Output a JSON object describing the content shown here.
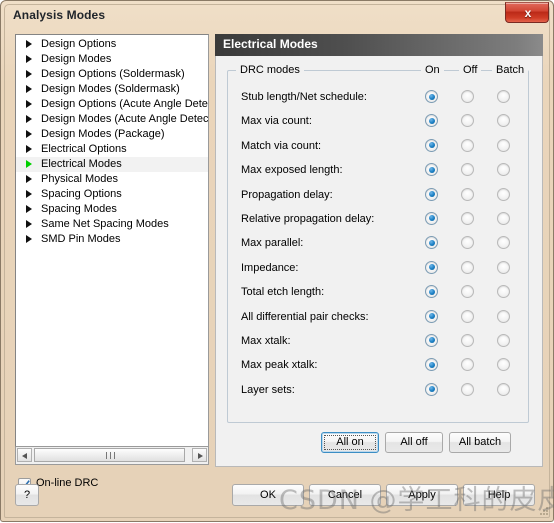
{
  "window": {
    "title": "Analysis Modes",
    "close_label": "x"
  },
  "tree": {
    "items": [
      {
        "label": "Design Options",
        "selected": false
      },
      {
        "label": "Design Modes",
        "selected": false
      },
      {
        "label": "Design Options (Soldermask)",
        "selected": false
      },
      {
        "label": "Design Modes  (Soldermask)",
        "selected": false
      },
      {
        "label": "Design Options (Acute Angle Detection)",
        "selected": false
      },
      {
        "label": "Design Modes  (Acute Angle Detection)",
        "selected": false
      },
      {
        "label": "Design Modes  (Package)",
        "selected": false
      },
      {
        "label": "Electrical Options",
        "selected": false
      },
      {
        "label": "Electrical Modes",
        "selected": true
      },
      {
        "label": "Physical Modes",
        "selected": false
      },
      {
        "label": "Spacing Options",
        "selected": false
      },
      {
        "label": "Spacing Modes",
        "selected": false
      },
      {
        "label": "Same Net Spacing Modes",
        "selected": false
      },
      {
        "label": "SMD Pin Modes",
        "selected": false
      }
    ]
  },
  "pane": {
    "header": "Electrical Modes",
    "group_title": "DRC modes",
    "columns": [
      "On",
      "Off",
      "Batch"
    ],
    "rows": [
      {
        "label": "Stub length/Net schedule:",
        "value": "On"
      },
      {
        "label": "Max via count:",
        "value": "On"
      },
      {
        "label": "Match via count:",
        "value": "On"
      },
      {
        "label": "Max exposed length:",
        "value": "On"
      },
      {
        "label": "Propagation delay:",
        "value": "On"
      },
      {
        "label": "Relative propagation delay:",
        "value": "On"
      },
      {
        "label": "Max parallel:",
        "value": "On"
      },
      {
        "label": "Impedance:",
        "value": "On"
      },
      {
        "label": "Total etch length:",
        "value": "On"
      },
      {
        "label": "All differential pair checks:",
        "value": "On"
      },
      {
        "label": "Max xtalk:",
        "value": "On"
      },
      {
        "label": "Max peak xtalk:",
        "value": "On"
      },
      {
        "label": "Layer sets:",
        "value": "On"
      }
    ],
    "buttons": {
      "all_on": "All on",
      "all_off": "All off",
      "all_batch": "All batch"
    }
  },
  "options": {
    "online_drc_label": "On-line DRC",
    "online_drc_checked": true
  },
  "footer": {
    "help_small": "?",
    "ok": "OK",
    "cancel": "Cancel",
    "apply": "Apply",
    "help": "Help"
  },
  "watermark": {
    "text": "CSDN @学工科的皮皮虎^_^"
  },
  "colors": {
    "accent_radio": "#1a7fc4",
    "selected_arrow": "#00d000",
    "title_frame": "#e6d2b8",
    "header_bar": "#3a3a3a",
    "focus_border": "#3c8ec4"
  }
}
